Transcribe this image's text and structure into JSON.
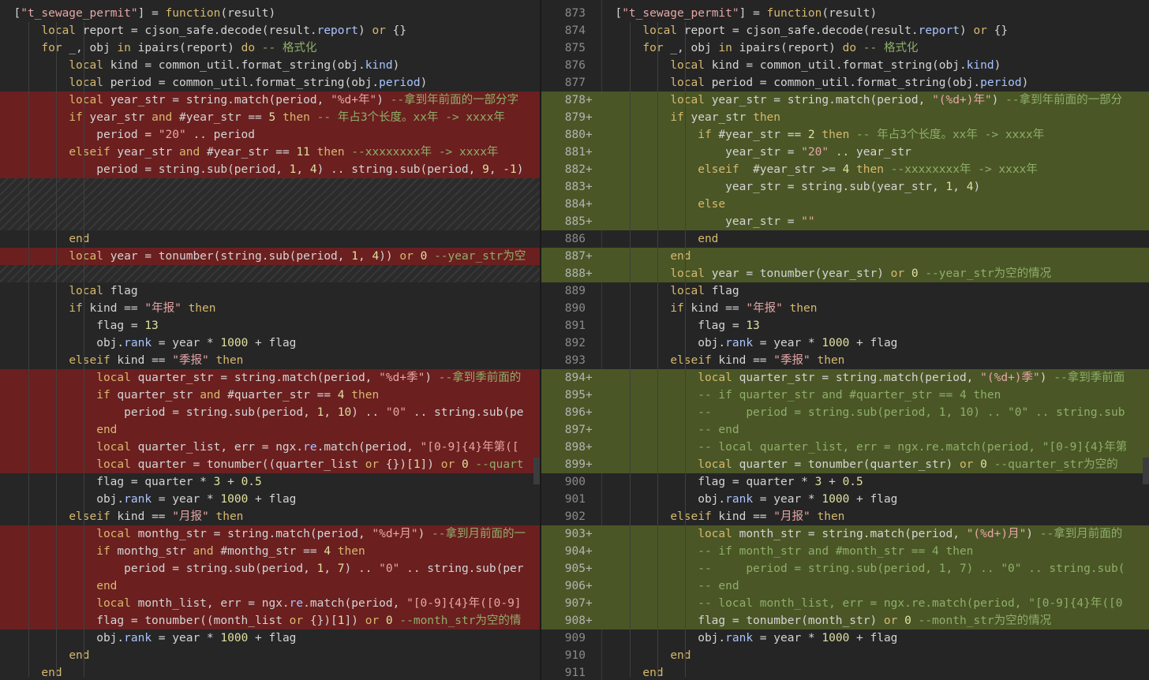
{
  "left": {
    "lines": [
      {
        "type": "ctx",
        "code": "  [\"t_sewage_permit\"] = function(result)"
      },
      {
        "type": "ctx",
        "code": "      local report = cjson_safe.decode(result.report) or {}"
      },
      {
        "type": "ctx",
        "code": "      for _, obj in ipairs(report) do -- 格式化"
      },
      {
        "type": "ctx",
        "code": "          local kind = common_util.format_string(obj.kind)"
      },
      {
        "type": "ctx",
        "code": "          local period = common_util.format_string(obj.period)"
      },
      {
        "type": "del",
        "code": "          local year_str = string.match(period, \"%d+年\") --拿到年前面的一部分字"
      },
      {
        "type": "del",
        "code": "          if year_str and #year_str == 5 then -- 年占3个长度。xx年 -> xxxx年"
      },
      {
        "type": "del",
        "code": "              period = \"20\" .. period"
      },
      {
        "type": "del",
        "code": "          elseif year_str and #year_str == 11 then --xxxxxxxx年 -> xxxx年"
      },
      {
        "type": "del",
        "code": "              period = string.sub(period, 1, 4) .. string.sub(period, 9, -1)"
      },
      {
        "type": "hatch",
        "code": ""
      },
      {
        "type": "hatch",
        "code": ""
      },
      {
        "type": "hatch",
        "code": ""
      },
      {
        "type": "ctx",
        "code": "          end"
      },
      {
        "type": "del",
        "code": "          local year = tonumber(string.sub(period, 1, 4)) or 0 --year_str为空"
      },
      {
        "type": "hatch",
        "code": ""
      },
      {
        "type": "ctx",
        "code": "          local flag"
      },
      {
        "type": "ctx",
        "code": "          if kind == \"年报\" then"
      },
      {
        "type": "ctx",
        "code": "              flag = 13"
      },
      {
        "type": "ctx",
        "code": "              obj.rank = year * 1000 + flag"
      },
      {
        "type": "ctx",
        "code": "          elseif kind == \"季报\" then"
      },
      {
        "type": "del",
        "code": "              local quarter_str = string.match(period, \"%d+季\") --拿到季前面的"
      },
      {
        "type": "del",
        "code": "              if quarter_str and #quarter_str == 4 then"
      },
      {
        "type": "del",
        "code": "                  period = string.sub(period, 1, 10) .. \"0\" .. string.sub(pe"
      },
      {
        "type": "del",
        "code": "              end"
      },
      {
        "type": "del",
        "code": "              local quarter_list, err = ngx.re.match(period, \"[0-9]{4}年第(["
      },
      {
        "type": "del",
        "code": "              local quarter = tonumber((quarter_list or {})[1]) or 0 --quart"
      },
      {
        "type": "ctx",
        "code": "              flag = quarter * 3 + 0.5"
      },
      {
        "type": "ctx",
        "code": "              obj.rank = year * 1000 + flag"
      },
      {
        "type": "ctx",
        "code": "          elseif kind == \"月报\" then"
      },
      {
        "type": "del",
        "code": "              local monthg_str = string.match(period, \"%d+月\") --拿到月前面的一"
      },
      {
        "type": "del",
        "code": "              if monthg_str and #monthg_str == 4 then"
      },
      {
        "type": "del",
        "code": "                  period = string.sub(period, 1, 7) .. \"0\" .. string.sub(per"
      },
      {
        "type": "del",
        "code": "              end"
      },
      {
        "type": "del",
        "code": "              local month_list, err = ngx.re.match(period, \"[0-9]{4}年([0-9]"
      },
      {
        "type": "del",
        "code": "              flag = tonumber((month_list or {})[1]) or 0 --month_str为空的情"
      },
      {
        "type": "ctx",
        "code": "              obj.rank = year * 1000 + flag"
      },
      {
        "type": "ctx",
        "code": "          end"
      },
      {
        "type": "ctx",
        "code": "      end"
      }
    ]
  },
  "right": {
    "lines": [
      {
        "ln": "873",
        "mk": "",
        "type": "ctx",
        "code": "  [\"t_sewage_permit\"] = function(result)"
      },
      {
        "ln": "874",
        "mk": "",
        "type": "ctx",
        "code": "      local report = cjson_safe.decode(result.report) or {}"
      },
      {
        "ln": "875",
        "mk": "",
        "type": "ctx",
        "code": "      for _, obj in ipairs(report) do -- 格式化"
      },
      {
        "ln": "876",
        "mk": "",
        "type": "ctx",
        "code": "          local kind = common_util.format_string(obj.kind)"
      },
      {
        "ln": "877",
        "mk": "",
        "type": "ctx",
        "code": "          local period = common_util.format_string(obj.period)"
      },
      {
        "ln": "878",
        "mk": "+",
        "type": "add",
        "code": "          local year_str = string.match(period, \"(%d+)年\") --拿到年前面的一部分"
      },
      {
        "ln": "879",
        "mk": "+",
        "type": "add",
        "code": "          if year_str then"
      },
      {
        "ln": "880",
        "mk": "+",
        "type": "add",
        "code": "              if #year_str == 2 then -- 年占3个长度。xx年 -> xxxx年"
      },
      {
        "ln": "881",
        "mk": "+",
        "type": "add",
        "code": "                  year_str = \"20\" .. year_str"
      },
      {
        "ln": "882",
        "mk": "+",
        "type": "add",
        "code": "              elseif  #year_str >= 4 then --xxxxxxxx年 -> xxxx年"
      },
      {
        "ln": "883",
        "mk": "+",
        "type": "add",
        "code": "                  year_str = string.sub(year_str, 1, 4)"
      },
      {
        "ln": "884",
        "mk": "+",
        "type": "add",
        "code": "              else"
      },
      {
        "ln": "885",
        "mk": "+",
        "type": "add",
        "code": "                  year_str = \"\""
      },
      {
        "ln": "886",
        "mk": "",
        "type": "ctx",
        "code": "              end"
      },
      {
        "ln": "887",
        "mk": "+",
        "type": "add",
        "code": "          end"
      },
      {
        "ln": "888",
        "mk": "+",
        "type": "add",
        "code": "          local year = tonumber(year_str) or 0 --year_str为空的情况"
      },
      {
        "ln": "889",
        "mk": "",
        "type": "ctx",
        "code": "          local flag"
      },
      {
        "ln": "890",
        "mk": "",
        "type": "ctx",
        "code": "          if kind == \"年报\" then"
      },
      {
        "ln": "891",
        "mk": "",
        "type": "ctx",
        "code": "              flag = 13"
      },
      {
        "ln": "892",
        "mk": "",
        "type": "ctx",
        "code": "              obj.rank = year * 1000 + flag"
      },
      {
        "ln": "893",
        "mk": "",
        "type": "ctx",
        "code": "          elseif kind == \"季报\" then"
      },
      {
        "ln": "894",
        "mk": "+",
        "type": "add",
        "code": "              local quarter_str = string.match(period, \"(%d+)季\") --拿到季前面"
      },
      {
        "ln": "895",
        "mk": "+",
        "type": "add",
        "code": "              -- if quarter_str and #quarter_str == 4 then"
      },
      {
        "ln": "896",
        "mk": "+",
        "type": "add",
        "code": "              --     period = string.sub(period, 1, 10) .. \"0\" .. string.sub"
      },
      {
        "ln": "897",
        "mk": "+",
        "type": "add",
        "code": "              -- end"
      },
      {
        "ln": "898",
        "mk": "+",
        "type": "add",
        "code": "              -- local quarter_list, err = ngx.re.match(period, \"[0-9]{4}年第"
      },
      {
        "ln": "899",
        "mk": "+",
        "type": "add",
        "code": "              local quarter = tonumber(quarter_str) or 0 --quarter_str为空的"
      },
      {
        "ln": "900",
        "mk": "",
        "type": "ctx",
        "code": "              flag = quarter * 3 + 0.5"
      },
      {
        "ln": "901",
        "mk": "",
        "type": "ctx",
        "code": "              obj.rank = year * 1000 + flag"
      },
      {
        "ln": "902",
        "mk": "",
        "type": "ctx",
        "code": "          elseif kind == \"月报\" then"
      },
      {
        "ln": "903",
        "mk": "+",
        "type": "add",
        "code": "              local month_str = string.match(period, \"(%d+)月\") --拿到月前面的"
      },
      {
        "ln": "904",
        "mk": "+",
        "type": "add",
        "code": "              -- if month_str and #month_str == 4 then"
      },
      {
        "ln": "905",
        "mk": "+",
        "type": "add",
        "code": "              --     period = string.sub(period, 1, 7) .. \"0\" .. string.sub("
      },
      {
        "ln": "906",
        "mk": "+",
        "type": "add",
        "code": "              -- end"
      },
      {
        "ln": "907",
        "mk": "+",
        "type": "add",
        "code": "              -- local month_list, err = ngx.re.match(period, \"[0-9]{4}年([0"
      },
      {
        "ln": "908",
        "mk": "+",
        "type": "add",
        "code": "              flag = tonumber(month_str) or 0 --month_str为空的情况"
      },
      {
        "ln": "909",
        "mk": "",
        "type": "ctx",
        "code": "              obj.rank = year * 1000 + flag"
      },
      {
        "ln": "910",
        "mk": "",
        "type": "ctx",
        "code": "          end"
      },
      {
        "ln": "911",
        "mk": "",
        "type": "ctx",
        "code": "      end"
      }
    ]
  },
  "colors": {
    "deleted": "#6b1f1f",
    "added": "#4a5626",
    "keyword": "#d7b96e",
    "string": "#e7a6a6",
    "comment": "#8fae6a"
  }
}
